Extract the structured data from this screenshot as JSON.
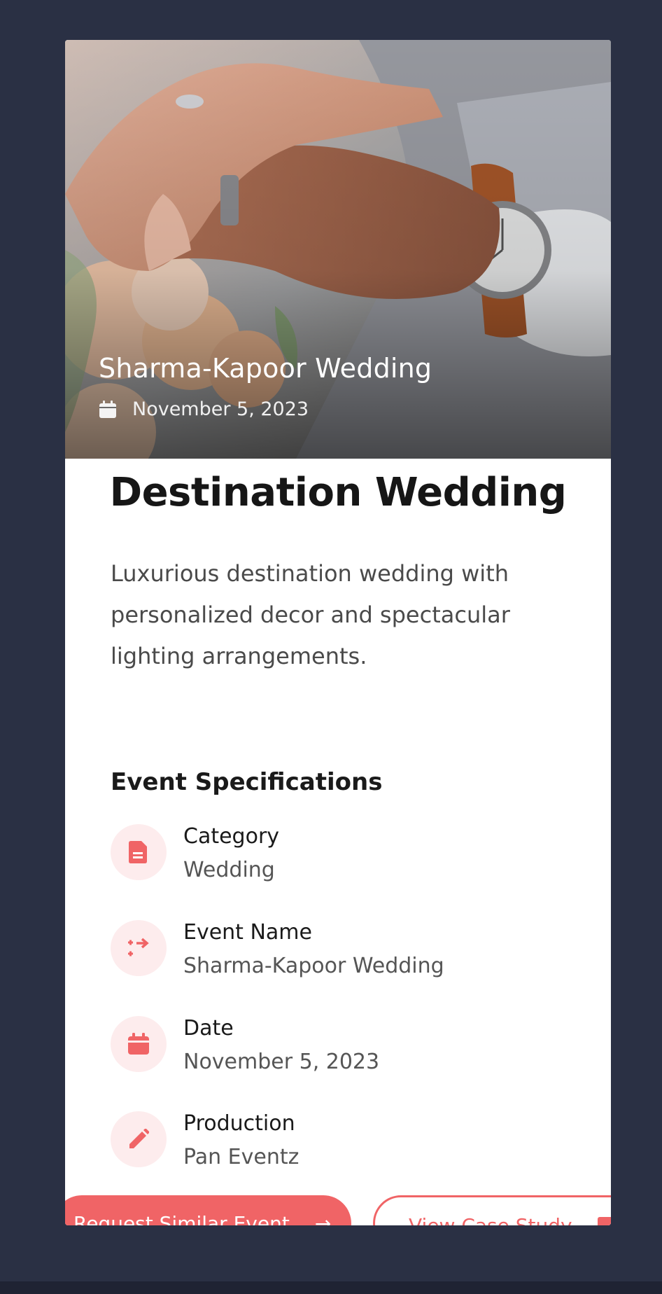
{
  "hero": {
    "title": "Sharma-Kapoor Wedding",
    "date": "November 5, 2023",
    "date_icon": "calendar-icon"
  },
  "headline": "Destination Wedding",
  "description": "Luxurious destination wedding with personalized decor and spectacular lighting arrangements.",
  "specs": {
    "heading": "Event Specifications",
    "items": [
      {
        "label": "Category",
        "value": "Wedding",
        "icon": "document-icon"
      },
      {
        "label": "Event Name",
        "value": "Sharma-Kapoor Wedding",
        "icon": "shuffle-arrows-icon"
      },
      {
        "label": "Date",
        "value": "November 5, 2023",
        "icon": "calendar-icon"
      },
      {
        "label": "Production",
        "value": "Pan Eventz",
        "icon": "pencil-icon"
      }
    ]
  },
  "actions": {
    "request_label": "Request Similar Event",
    "case_study_label": "View Case Study"
  },
  "colors": {
    "accent": "#f06466",
    "icon_bg": "#fdeced",
    "page_bg": "#2a3044"
  }
}
